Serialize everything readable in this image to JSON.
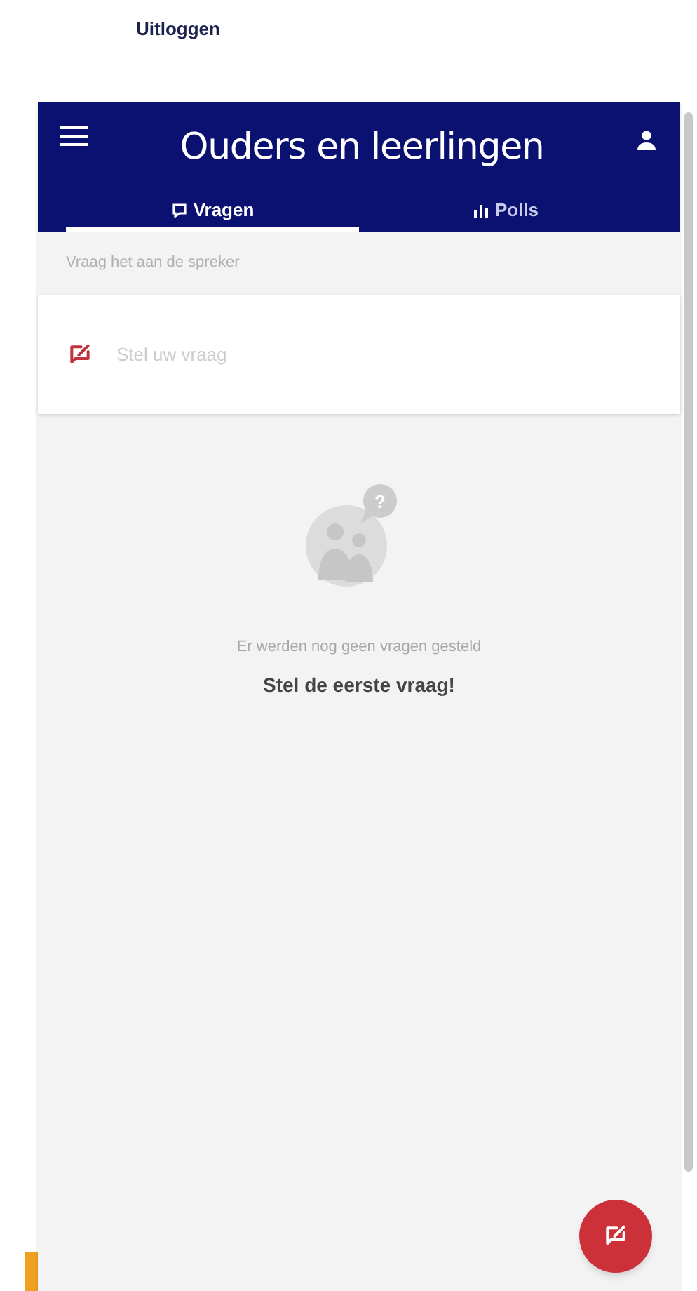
{
  "logout_link": "Uitloggen",
  "header": {
    "title": "Ouders en leerlingen"
  },
  "tabs": [
    {
      "label": "Vragen",
      "kind": "questions",
      "selected": true
    },
    {
      "label": "Polls",
      "kind": "polls",
      "selected": false
    }
  ],
  "section_label": "Vraag het aan de spreker",
  "question_input": {
    "placeholder": "Stel uw vraag"
  },
  "empty_state": {
    "icon_glyph": "?",
    "message": "Er werden nog geen vragen gesteld",
    "call_to_action": "Stel de eerste vraag!"
  }
}
